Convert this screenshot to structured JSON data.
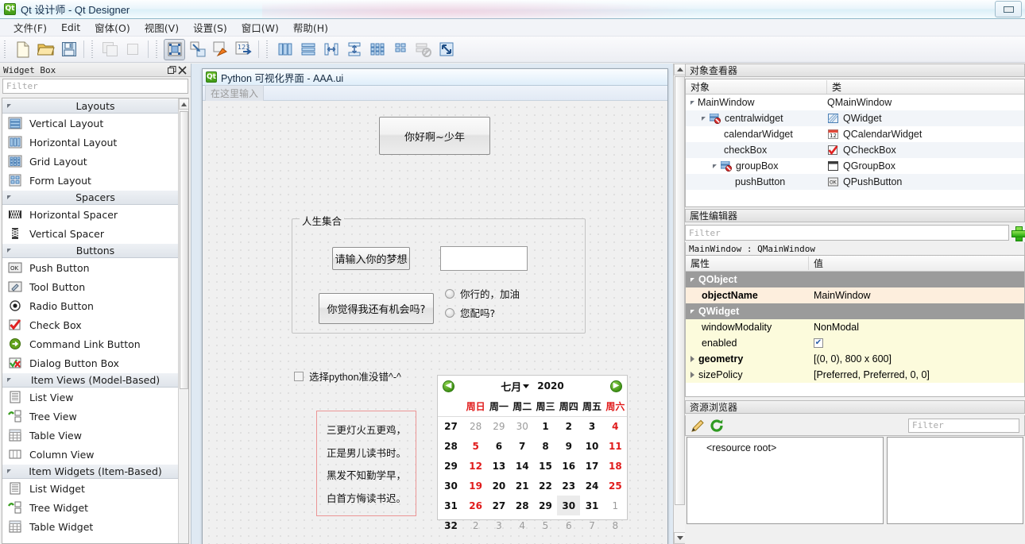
{
  "window": {
    "title": "Qt 设计师 - Qt Designer",
    "logo": "Qt",
    "restore_label": "restore-window"
  },
  "menubar": {
    "items": [
      {
        "label": "文件(F)",
        "name": "menu-file"
      },
      {
        "label": "Edit",
        "name": "menu-edit"
      },
      {
        "label": "窗体(O)",
        "name": "menu-form"
      },
      {
        "label": "视图(V)",
        "name": "menu-view"
      },
      {
        "label": "设置(S)",
        "name": "menu-settings"
      },
      {
        "label": "窗口(W)",
        "name": "menu-window"
      },
      {
        "label": "帮助(H)",
        "name": "menu-help"
      }
    ]
  },
  "toolbar": {
    "groups": [
      [
        "new-file-icon",
        "open-folder-icon",
        "save-icon"
      ],
      [
        "undo-icon",
        "redo-icon"
      ],
      [
        "edit-widgets-icon",
        "edit-signals-slots-icon",
        "edit-buddies-icon",
        "edit-tab-order-icon"
      ],
      [
        "layout-horizontally-icon",
        "layout-vertically-icon",
        "layout-splitter-horizontal-icon",
        "layout-splitter-vertical-icon",
        "layout-grid-icon",
        "layout-form-icon",
        "break-layout-icon",
        "adjust-size-icon"
      ]
    ]
  },
  "widget_box": {
    "title": "Widget Box",
    "filter_placeholder": "Filter",
    "float_icon": "float-icon",
    "close_icon": "close-icon",
    "sections": [
      {
        "name": "Layouts",
        "items": [
          {
            "label": "Vertical Layout",
            "icon": "vertical-layout-icon"
          },
          {
            "label": "Horizontal Layout",
            "icon": "horizontal-layout-icon"
          },
          {
            "label": "Grid Layout",
            "icon": "grid-layout-icon"
          },
          {
            "label": "Form Layout",
            "icon": "form-layout-icon"
          }
        ]
      },
      {
        "name": "Spacers",
        "items": [
          {
            "label": "Horizontal Spacer",
            "icon": "horizontal-spacer-icon"
          },
          {
            "label": "Vertical Spacer",
            "icon": "vertical-spacer-icon"
          }
        ]
      },
      {
        "name": "Buttons",
        "items": [
          {
            "label": "Push Button",
            "icon": "push-button-icon"
          },
          {
            "label": "Tool Button",
            "icon": "tool-button-icon"
          },
          {
            "label": "Radio Button",
            "icon": "radio-button-icon"
          },
          {
            "label": "Check Box",
            "icon": "check-box-icon"
          },
          {
            "label": "Command Link Button",
            "icon": "command-link-icon"
          },
          {
            "label": "Dialog Button Box",
            "icon": "dialog-button-box-icon"
          }
        ]
      },
      {
        "name": "Item Views (Model-Based)",
        "items": [
          {
            "label": "List View",
            "icon": "list-view-icon"
          },
          {
            "label": "Tree View",
            "icon": "tree-view-icon"
          },
          {
            "label": "Table View",
            "icon": "table-view-icon"
          },
          {
            "label": "Column View",
            "icon": "column-view-icon"
          }
        ]
      },
      {
        "name": "Item Widgets (Item-Based)",
        "items": [
          {
            "label": "List Widget",
            "icon": "list-widget-icon"
          },
          {
            "label": "Tree Widget",
            "icon": "tree-widget-icon"
          },
          {
            "label": "Table Widget",
            "icon": "table-widget-icon"
          }
        ]
      }
    ]
  },
  "form": {
    "title": "Python 可视化界面 - AAA.ui",
    "logo": "Qt",
    "menubar_placeholder": "在这里输入",
    "greeting_button": "你好啊~少年",
    "group_title": "人生集合",
    "dream_button": "请输入你的梦想",
    "dream_input_value": "",
    "chance_button": "你觉得我还有机会吗?",
    "radio1": "你行的，加油",
    "radio2": "您配吗?",
    "checkbox": "选择python准没错^-^",
    "poem": [
      "三更灯火五更鸡，",
      "正是男儿读书时。",
      "黑发不知勤学早，",
      "白首方悔读书迟。"
    ],
    "calendar": {
      "prev_icon": "previous-month-icon",
      "next_icon": "next-month-icon",
      "month": "七月",
      "year": "2020",
      "weekday_headers": [
        "周日",
        "周一",
        "周二",
        "周三",
        "周四",
        "周五",
        "周六"
      ],
      "week_numbers": [
        "27",
        "28",
        "29",
        "30",
        "31",
        "32"
      ],
      "weeks": [
        [
          {
            "d": "28",
            "s": "dim"
          },
          {
            "d": "29",
            "s": "dim"
          },
          {
            "d": "30",
            "s": "dim"
          },
          {
            "d": "1",
            "s": ""
          },
          {
            "d": "2",
            "s": ""
          },
          {
            "d": "3",
            "s": ""
          },
          {
            "d": "4",
            "s": "red"
          }
        ],
        [
          {
            "d": "5",
            "s": "red"
          },
          {
            "d": "6",
            "s": ""
          },
          {
            "d": "7",
            "s": ""
          },
          {
            "d": "8",
            "s": ""
          },
          {
            "d": "9",
            "s": ""
          },
          {
            "d": "10",
            "s": ""
          },
          {
            "d": "11",
            "s": "red"
          }
        ],
        [
          {
            "d": "12",
            "s": "red"
          },
          {
            "d": "13",
            "s": ""
          },
          {
            "d": "14",
            "s": ""
          },
          {
            "d": "15",
            "s": ""
          },
          {
            "d": "16",
            "s": ""
          },
          {
            "d": "17",
            "s": ""
          },
          {
            "d": "18",
            "s": "red"
          }
        ],
        [
          {
            "d": "19",
            "s": "red"
          },
          {
            "d": "20",
            "s": ""
          },
          {
            "d": "21",
            "s": ""
          },
          {
            "d": "22",
            "s": ""
          },
          {
            "d": "23",
            "s": ""
          },
          {
            "d": "24",
            "s": ""
          },
          {
            "d": "25",
            "s": "red"
          }
        ],
        [
          {
            "d": "26",
            "s": "red"
          },
          {
            "d": "27",
            "s": ""
          },
          {
            "d": "28",
            "s": ""
          },
          {
            "d": "29",
            "s": ""
          },
          {
            "d": "30",
            "s": "sel"
          },
          {
            "d": "31",
            "s": ""
          },
          {
            "d": "1",
            "s": "dim"
          }
        ],
        [
          {
            "d": "2",
            "s": "dim"
          },
          {
            "d": "3",
            "s": "dim"
          },
          {
            "d": "4",
            "s": "dim"
          },
          {
            "d": "5",
            "s": "dim"
          },
          {
            "d": "6",
            "s": "dim"
          },
          {
            "d": "7",
            "s": "dim"
          },
          {
            "d": "8",
            "s": "dim"
          }
        ]
      ]
    }
  },
  "object_inspector": {
    "title": "对象查看器",
    "columns": [
      "对象",
      "类"
    ],
    "rows": [
      {
        "name": "MainWindow",
        "class": "QMainWindow",
        "indent": 0,
        "expander": "open",
        "icon": ""
      },
      {
        "name": "centralwidget",
        "class": "QWidget",
        "indent": 1,
        "expander": "open",
        "icon": "central-widget-icon"
      },
      {
        "name": "calendarWidget",
        "class": "QCalendarWidget",
        "indent": 2,
        "expander": "",
        "icon": "calendar-icon"
      },
      {
        "name": "checkBox",
        "class": "QCheckBox",
        "indent": 2,
        "expander": "",
        "icon": "check-box-icon"
      },
      {
        "name": "groupBox",
        "class": "QGroupBox",
        "indent": 2,
        "expander": "open",
        "icon": "group-box-icon"
      },
      {
        "name": "pushButton",
        "class": "QPushButton",
        "indent": 3,
        "expander": "",
        "icon": "push-button-icon"
      }
    ]
  },
  "property_editor": {
    "title": "属性编辑器",
    "filter_placeholder": "Filter",
    "add_icon": "add-property-icon",
    "object_line": "MainWindow : QMainWindow",
    "columns": [
      "属性",
      "值"
    ],
    "rows": [
      {
        "key": "QObject",
        "value": "",
        "type": "group"
      },
      {
        "key": "objectName",
        "value": "MainWindow",
        "type": "peach",
        "bold": true
      },
      {
        "key": "QWidget",
        "value": "",
        "type": "group"
      },
      {
        "key": "windowModality",
        "value": "NonModal",
        "type": "cream"
      },
      {
        "key": "enabled",
        "value": "✔",
        "type": "cream-check"
      },
      {
        "key": "geometry",
        "value": "[(0, 0), 800 x 600]",
        "type": "cream-expand",
        "bold": true
      },
      {
        "key": "sizePolicy",
        "value": "[Preferred, Preferred, 0, 0]",
        "type": "cream-expand",
        "bold": false
      }
    ]
  },
  "resource_browser": {
    "title": "资源浏览器",
    "edit_icon": "pencil-edit-icon",
    "reload_icon": "reload-icon",
    "filter_placeholder": "Filter",
    "root_label": "<resource root>"
  }
}
